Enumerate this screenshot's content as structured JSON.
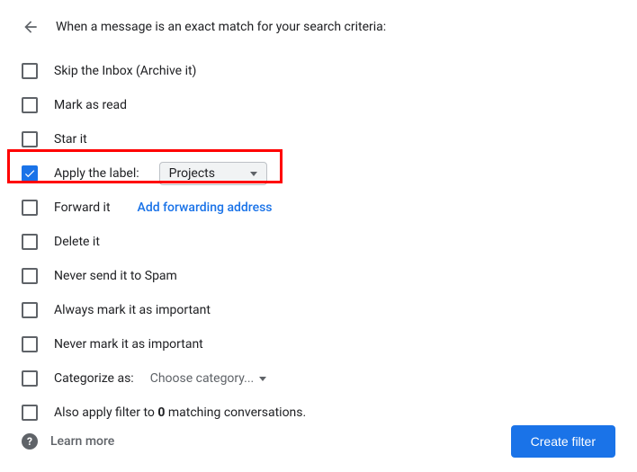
{
  "header": {
    "title": "When a message is an exact match for your search criteria:"
  },
  "options": {
    "skip_inbox": {
      "label": "Skip the Inbox (Archive it)",
      "checked": false
    },
    "mark_as_read": {
      "label": "Mark as read",
      "checked": false
    },
    "star_it": {
      "label": "Star it",
      "checked": false
    },
    "apply_label": {
      "label": "Apply the label:",
      "checked": true,
      "value": "Projects"
    },
    "forward_it": {
      "label": "Forward it",
      "checked": false,
      "link": "Add forwarding address"
    },
    "delete_it": {
      "label": "Delete it",
      "checked": false
    },
    "never_spam": {
      "label": "Never send it to Spam",
      "checked": false
    },
    "always_important": {
      "label": "Always mark it as important",
      "checked": false
    },
    "never_important": {
      "label": "Never mark it as important",
      "checked": false
    },
    "categorize_as": {
      "label": "Categorize as:",
      "checked": false,
      "value": "Choose category..."
    },
    "also_apply": {
      "prefix": "Also apply filter to ",
      "count": "0",
      "suffix": " matching conversations.",
      "checked": false
    }
  },
  "footer": {
    "learn_more": "Learn more",
    "create_filter": "Create filter"
  }
}
